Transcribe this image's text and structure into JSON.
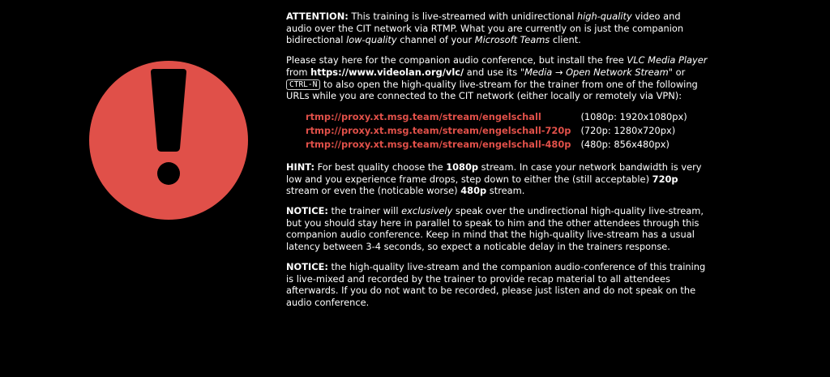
{
  "colors": {
    "background": "#000000",
    "text": "#ffffff",
    "accent": "#e05049"
  },
  "warning_icon": "exclamation-mark-icon",
  "attention": {
    "label": "ATTENTION:",
    "t1": " This training is live-streamed with unidirectional ",
    "i1": "high-quality",
    "t2": " video and audio over the CIT network via RTMP. What you are currently on is just the companion bidirectional ",
    "i2": "low-quality",
    "t3": " channel of your ",
    "i3": "Microsoft Teams",
    "t4": " client."
  },
  "install": {
    "t1": "Please stay here for the companion audio conference, but install the free ",
    "i1": "VLC Media Player",
    "t2": " from ",
    "link": "https://www.videolan.org/vlc/",
    "t3": " and use its \"",
    "i2": "Media → Open Network Stream",
    "t4": "\" or ",
    "kbd": "CTRL-N",
    "t5": " to also open the high-quality live-stream for the trainer from one of the following URLs while you are connected to the CIT network (either locally or remotely via VPN):"
  },
  "streams": [
    {
      "url": "rtmp://proxy.xt.msg.team/stream/engelschall",
      "resolution": "(1080p: 1920x1080px)"
    },
    {
      "url": "rtmp://proxy.xt.msg.team/stream/engelschall-720p",
      "resolution": "(720p: 1280x720px)"
    },
    {
      "url": "rtmp://proxy.xt.msg.team/stream/engelschall-480p",
      "resolution": "(480p: 856x480px)"
    }
  ],
  "hint": {
    "label": "HINT:",
    "t1": " For best quality choose the ",
    "b1": "1080p",
    "t2": " stream. In case your network bandwidth is very low and you experience frame drops, step down to either the (still acceptable) ",
    "b2": "720p",
    "t3": " stream or even the (noticable worse) ",
    "b3": "480p",
    "t4": " stream."
  },
  "notice1": {
    "label": "NOTICE:",
    "t1": " the trainer will ",
    "i1": "exclusively",
    "t2": " speak over the undirectional high-quality live-stream, but you should stay here in parallel to speak to him and the other attendees through this companion audio conference. Keep in mind that the high-quality live-stream has a usual latency between 3-4 seconds, so expect a noticable delay in the trainers response."
  },
  "notice2": {
    "label": "NOTICE:",
    "t1": " the high-quality live-stream and the companion audio-conference of this training is live-mixed and recorded by the trainer to provide recap material to all attendees afterwards. If you do not want to be recorded, please just listen and do not speak on the audio conference."
  }
}
